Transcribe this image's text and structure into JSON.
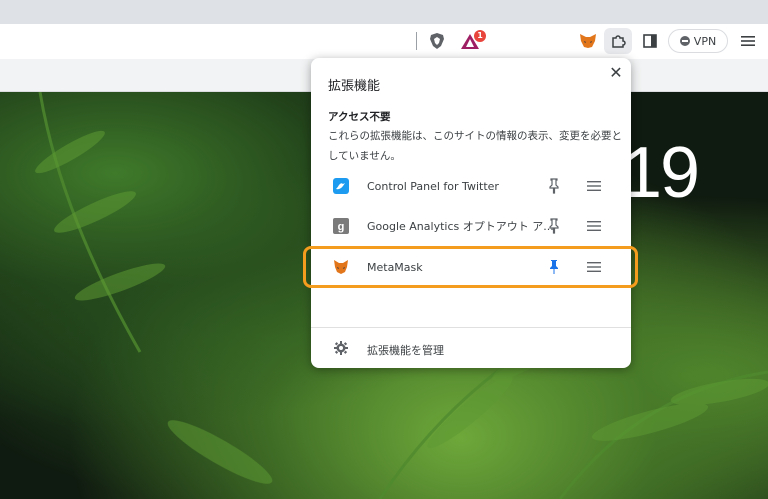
{
  "toolbar": {
    "bat_badge": "1",
    "vpn_label": "VPN"
  },
  "page": {
    "big_number": "19"
  },
  "popup": {
    "title": "拡張機能",
    "close": "✕",
    "section_heading": "アクセス不要",
    "section_description": "これらの拡張機能は、このサイトの情報の表示、変更を必要としていません。",
    "extensions": [
      {
        "name": "Control Panel for Twitter",
        "icon": "twitter-bird-icon",
        "pinned": false
      },
      {
        "name": "Google Analytics オプトアウト ア...",
        "icon": "google-analytics-icon",
        "pinned": false
      },
      {
        "name": "MetaMask",
        "icon": "metamask-fox-icon",
        "pinned": true
      }
    ],
    "manage_label": "拡張機能を管理"
  },
  "colors": {
    "highlight": "#f39c1d",
    "pin_active": "#1a73e8",
    "pin_inactive": "#5f6368"
  }
}
